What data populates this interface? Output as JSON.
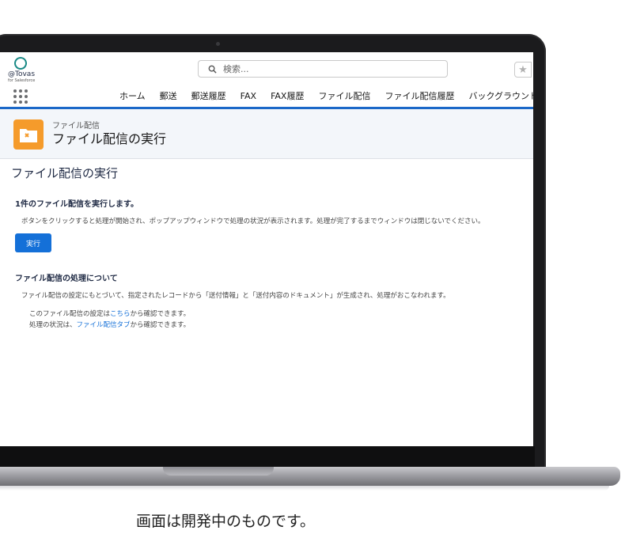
{
  "search": {
    "placeholder": "検索..."
  },
  "logo": {
    "name": "@Tovas",
    "sub": "for Salesforce"
  },
  "nav": {
    "items": [
      "ホーム",
      "郵送",
      "郵送履歴",
      "FAX",
      "FAX履歴",
      "ファイル配信",
      "ファイル配信履歴",
      "バックグラウンド処"
    ]
  },
  "header": {
    "breadcrumb": "ファイル配信",
    "title": "ファイル配信の実行"
  },
  "main": {
    "page_title": "ファイル配信の実行",
    "sub_heading": "1件のファイル配信を実行します。",
    "description": "ボタンをクリックすると処理が開始され、ポップアップウィンドウで処理の状況が表示されます。処理が完了するまでウィンドウは閉じないでください。",
    "run_button": "実行",
    "about_heading": "ファイル配信の処理について",
    "about_text": "ファイル配信の設定にもとづいて、指定されたレコードから「送付情報」と「送付内容のドキュメント」が生成され、処理がおこなわれます。",
    "note1_before": "このファイル配信の設定は",
    "note1_link": "こちら",
    "note1_after": "から確認できます。",
    "note2_before": "処理の状況は、",
    "note2_link": "ファイル配信タブ",
    "note2_after": "から確認できます。"
  },
  "caption": "画面は開発中のものです。",
  "colors": {
    "accent": "#1470d8",
    "object_icon": "#f59b2b",
    "nav_underline": "#1b68c8"
  }
}
